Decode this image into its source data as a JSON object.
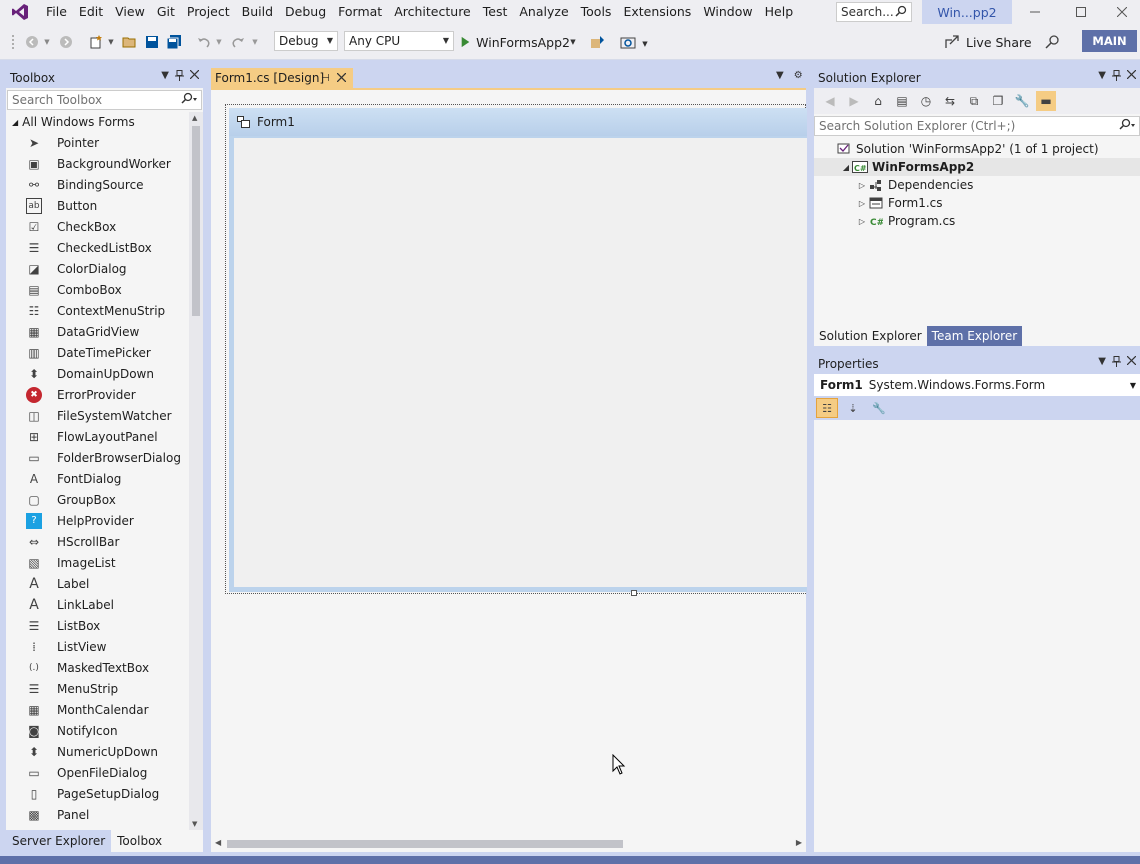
{
  "menu": {
    "items": [
      "File",
      "Edit",
      "View",
      "Git",
      "Project",
      "Build",
      "Debug",
      "Format",
      "Architecture",
      "Test",
      "Analyze",
      "Tools",
      "Extensions",
      "Window",
      "Help"
    ],
    "search_placeholder": "Search...",
    "solution_name": "Win...pp2"
  },
  "toolbar": {
    "config": "Debug",
    "platform": "Any CPU",
    "run_target": "WinFormsApp2",
    "live_share": "Live Share",
    "branch_badge": "MAIN"
  },
  "toolbox": {
    "title": "Toolbox",
    "search_placeholder": "Search Toolbox",
    "group": "All Windows Forms",
    "items": [
      {
        "label": "Pointer",
        "icon": "pointer-icon"
      },
      {
        "label": "BackgroundWorker",
        "icon": "backgroundworker-icon"
      },
      {
        "label": "BindingSource",
        "icon": "bindingsource-icon"
      },
      {
        "label": "Button",
        "icon": "button-icon"
      },
      {
        "label": "CheckBox",
        "icon": "checkbox-icon"
      },
      {
        "label": "CheckedListBox",
        "icon": "checkedlistbox-icon"
      },
      {
        "label": "ColorDialog",
        "icon": "colordialog-icon"
      },
      {
        "label": "ComboBox",
        "icon": "combobox-icon"
      },
      {
        "label": "ContextMenuStrip",
        "icon": "contextmenustrip-icon"
      },
      {
        "label": "DataGridView",
        "icon": "datagridview-icon"
      },
      {
        "label": "DateTimePicker",
        "icon": "datetimepicker-icon"
      },
      {
        "label": "DomainUpDown",
        "icon": "domainupdown-icon"
      },
      {
        "label": "ErrorProvider",
        "icon": "errorprovider-icon"
      },
      {
        "label": "FileSystemWatcher",
        "icon": "filesystemwatcher-icon"
      },
      {
        "label": "FlowLayoutPanel",
        "icon": "flowlayoutpanel-icon"
      },
      {
        "label": "FolderBrowserDialog",
        "icon": "folderbrowserdialog-icon"
      },
      {
        "label": "FontDialog",
        "icon": "fontdialog-icon"
      },
      {
        "label": "GroupBox",
        "icon": "groupbox-icon"
      },
      {
        "label": "HelpProvider",
        "icon": "helpprovider-icon"
      },
      {
        "label": "HScrollBar",
        "icon": "hscrollbar-icon"
      },
      {
        "label": "ImageList",
        "icon": "imagelist-icon"
      },
      {
        "label": "Label",
        "icon": "label-icon"
      },
      {
        "label": "LinkLabel",
        "icon": "linklabel-icon"
      },
      {
        "label": "ListBox",
        "icon": "listbox-icon"
      },
      {
        "label": "ListView",
        "icon": "listview-icon"
      },
      {
        "label": "MaskedTextBox",
        "icon": "maskedtextbox-icon"
      },
      {
        "label": "MenuStrip",
        "icon": "menustrip-icon"
      },
      {
        "label": "MonthCalendar",
        "icon": "monthcalendar-icon"
      },
      {
        "label": "NotifyIcon",
        "icon": "notifyicon-icon"
      },
      {
        "label": "NumericUpDown",
        "icon": "numericupdown-icon"
      },
      {
        "label": "OpenFileDialog",
        "icon": "openfiledialog-icon"
      },
      {
        "label": "PageSetupDialog",
        "icon": "pagesetupdialog-icon"
      },
      {
        "label": "Panel",
        "icon": "panel-icon"
      }
    ],
    "bottom_tabs": [
      "Server Explorer",
      "Toolbox"
    ]
  },
  "editor": {
    "tab_title": "Form1.cs [Design]",
    "form_title": "Form1"
  },
  "solution_explorer": {
    "title": "Solution Explorer",
    "search_placeholder": "Search Solution Explorer (Ctrl+;)",
    "tree": [
      {
        "label": "Solution 'WinFormsApp2' (1 of 1 project)",
        "level": 0,
        "expander": "",
        "icon": "solution-icon"
      },
      {
        "label": "WinFormsApp2",
        "level": 1,
        "expander": "expanded",
        "icon": "csharp-project-icon"
      },
      {
        "label": "Dependencies",
        "level": 2,
        "expander": "collapsed",
        "icon": "dependencies-icon"
      },
      {
        "label": "Form1.cs",
        "level": 2,
        "expander": "collapsed",
        "icon": "form-file-icon"
      },
      {
        "label": "Program.cs",
        "level": 2,
        "expander": "collapsed",
        "icon": "csharp-file-icon"
      }
    ],
    "tabs": [
      "Solution Explorer",
      "Team Explorer"
    ]
  },
  "properties": {
    "title": "Properties",
    "object_name": "Form1",
    "object_type": "System.Windows.Forms.Form"
  },
  "colors": {
    "accent": "#5e70a8",
    "active_tab": "#f5cc84",
    "chrome": "#ccd5f0"
  }
}
